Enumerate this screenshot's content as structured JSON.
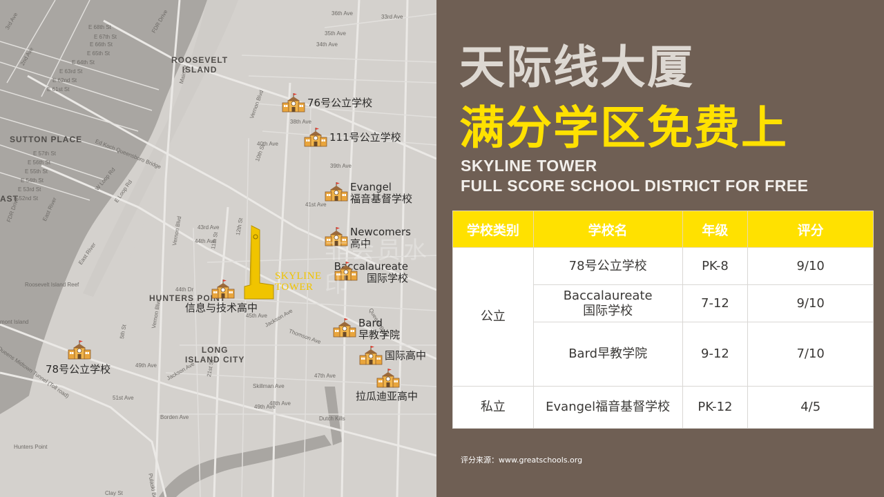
{
  "title_cn": "天际线大厦",
  "subtitle_cn": "满分学区免费上",
  "title_en_line1": "SKYLINE TOWER",
  "title_en_line2": "FULL SCORE SCHOOL DISTRICT FOR FREE",
  "watermark": "非会员水印",
  "map": {
    "tower_label_1": "SKYLINE",
    "tower_label_2": "TOWER",
    "areas": {
      "roosevelt_1": "ROOSEVELT",
      "roosevelt_2": "ISLAND",
      "sutton": "SUTTON PLACE",
      "east": "AST",
      "hunters_point": "HUNTERS POINT",
      "lic_1": "LONG",
      "lic_2": "ISLAND CITY"
    },
    "streets": [
      "3rd Ave",
      "2nd Ave",
      "E 68th St",
      "E 67th St",
      "E 66th St",
      "E 65th St",
      "E 64th St",
      "E 63rd St",
      "E 62nd St",
      "E 61st St",
      "FDR Drive",
      "Main St",
      "E 57th St",
      "E 56th St",
      "E 55th St",
      "E 54th St",
      "E 53rd St",
      "E 52nd St",
      "FDR Drive",
      "W Loop Rd",
      "E Loop Rd",
      "East River",
      "East River",
      "Ed Koch Queensboro Bridge",
      "Vernon Blvd",
      "38th Ave",
      "40th Ave",
      "10th St",
      "39th Ave",
      "41st Ave",
      "43rd Ave",
      "44th Ave",
      "Vernon Blvd",
      "11th St",
      "12th St",
      "44th Dr",
      "45th Ave",
      "Jackson Ave",
      "Thomson Ave",
      "Queens Blvd",
      "Vernon Blvd",
      "5th St",
      "49th Ave",
      "Jackson Ave",
      "21st St",
      "51st Ave",
      "Borden Ave",
      "Skillman Ave",
      "47th Ave",
      "48th Ave",
      "49th Ave",
      "Hunters Point",
      "Clay St",
      "Pulaski Bridge",
      "Queens Midtown Tunnel (Toll road)",
      "36th Ave",
      "35th Ave",
      "34th Ave",
      "33rd Ave",
      "Roosevelt Island Reef",
      "mont Island",
      "Dutch Kills"
    ],
    "schools": [
      {
        "name_1": "76号公立学校",
        "name_2": ""
      },
      {
        "name_1": "111号公立学校",
        "name_2": ""
      },
      {
        "name_1": "Evangel",
        "name_2": "福音基督学校"
      },
      {
        "name_1": "Newcomers",
        "name_2": "高中"
      },
      {
        "name_1": "Baccalaureate",
        "name_2": "国际学校"
      },
      {
        "name_1": "信息与技术高中",
        "name_2": ""
      },
      {
        "name_1": "Bard",
        "name_2": "早教学院"
      },
      {
        "name_1": "国际高中",
        "name_2": ""
      },
      {
        "name_1": "拉瓜迪亚高中",
        "name_2": ""
      },
      {
        "name_1": "78号公立学校",
        "name_2": ""
      }
    ]
  },
  "table": {
    "headers": [
      "学校类别",
      "学校名",
      "年级",
      "评分"
    ],
    "category_public": "公立",
    "category_private": "私立",
    "rows": [
      {
        "name_1": "78号公立学校",
        "name_2": "",
        "grade": "PK-8",
        "rating": "9/10"
      },
      {
        "name_1": "Baccalaureate",
        "name_2": "国际学校",
        "grade": "7-12",
        "rating": "9/10"
      },
      {
        "name_1": "Bard早教学院",
        "name_2": "",
        "grade": "9-12",
        "rating": "7/10"
      },
      {
        "name_1": "Evangel福音基督学校",
        "name_2": "",
        "grade": "PK-12",
        "rating": "4/5"
      }
    ]
  },
  "source_note": "评分来源：www.greatschools.org",
  "colors": {
    "panel_bg": "#6f5f54",
    "accent_yellow": "#ffe100",
    "title_light": "#ddd8d2",
    "map_land": "#d4d1cd",
    "map_water": "#a9a6a2"
  }
}
